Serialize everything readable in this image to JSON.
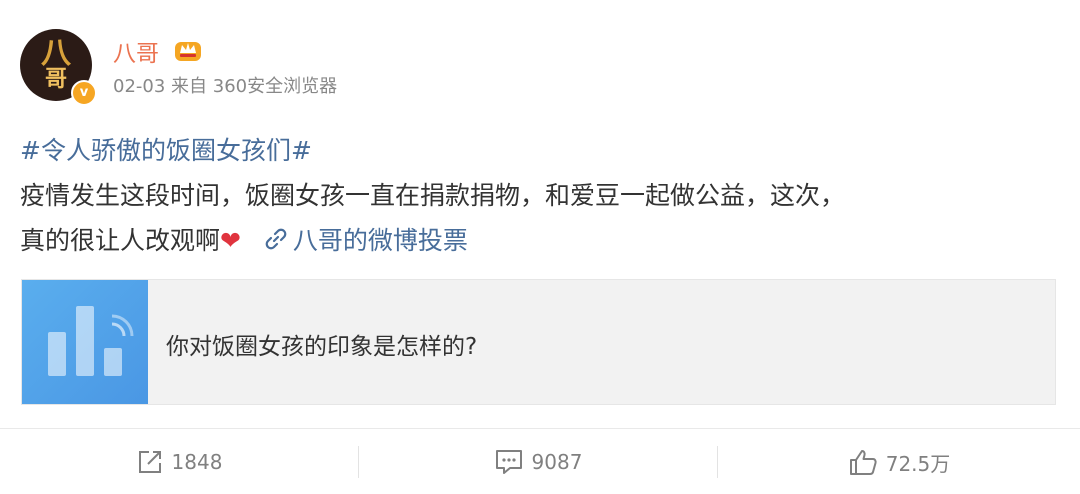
{
  "user": {
    "name": "八哥",
    "avatar_text": "八哥",
    "verified_mark": "v",
    "meta": "02-03 来自 360安全浏览器",
    "badge_icon": "crown-icon"
  },
  "post": {
    "topic": "#令人骄傲的饭圈女孩们#",
    "line1": "疫情发生这段时间，饭圈女孩一直在捐款捐物，和爱豆一起做公益，这次，",
    "line2": "真的很让人改观啊",
    "heart": "❤",
    "link_label": "八哥的微博投票"
  },
  "card": {
    "title": "你对饭圈女孩的印象是怎样的?",
    "thumb_color": "#4e9ee8"
  },
  "actions": {
    "repost_count": "1848",
    "comment_count": "9087",
    "like_count": "72.5万"
  },
  "colors": {
    "username": "#eb7350",
    "link": "#486d9a",
    "muted": "#808080"
  }
}
